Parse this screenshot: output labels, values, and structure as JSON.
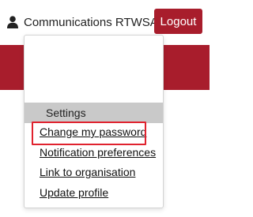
{
  "colors": {
    "brand_red": "#a81d2c",
    "highlight_red": "#e0222e",
    "menu_header_bg": "#c9c9c9"
  },
  "navbar": {
    "user_icon": "user-icon",
    "user_name": "Communications RTWSA",
    "caret_icon": "caret-down-icon",
    "logout_label": "Logout"
  },
  "dropdown": {
    "header": "Settings",
    "items": [
      {
        "label": "Change my password",
        "highlighted": true
      },
      {
        "label": "Notification preferences"
      },
      {
        "label": "Link to organisation"
      },
      {
        "label": "Update profile"
      }
    ]
  }
}
